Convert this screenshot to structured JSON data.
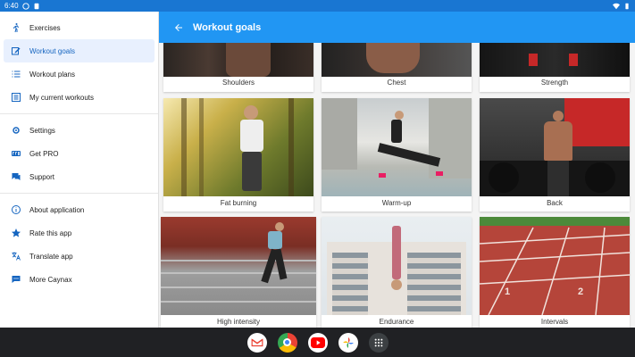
{
  "status_bar": {
    "time": "6:40"
  },
  "sidebar": {
    "items": [
      {
        "label": "Exercises",
        "icon": "walking-person-icon"
      },
      {
        "label": "Workout goals",
        "icon": "edit-icon",
        "active": true
      },
      {
        "label": "Workout plans",
        "icon": "list-icon"
      },
      {
        "label": "My current workouts",
        "icon": "checklist-icon"
      },
      {
        "label": "Settings",
        "icon": "settings-icon"
      },
      {
        "label": "Get PRO",
        "icon": "pro-badge-icon"
      },
      {
        "label": "Support",
        "icon": "chat-icon"
      },
      {
        "label": "About application",
        "icon": "info-icon"
      },
      {
        "label": "Rate this app",
        "icon": "star-icon"
      },
      {
        "label": "Translate app",
        "icon": "translate-icon"
      },
      {
        "label": "More Caynax",
        "icon": "more-apps-icon"
      }
    ]
  },
  "appbar": {
    "title": "Workout goals"
  },
  "goals": [
    {
      "label": "Shoulders"
    },
    {
      "label": "Chest"
    },
    {
      "label": "Strength"
    },
    {
      "label": "Fat burning"
    },
    {
      "label": "Warm-up"
    },
    {
      "label": "Back"
    },
    {
      "label": "High intensity"
    },
    {
      "label": "Endurance"
    },
    {
      "label": "Intervals"
    }
  ],
  "taskbar": {
    "apps": [
      "gmail-icon",
      "chrome-icon",
      "youtube-icon",
      "photos-icon",
      "app-launcher-icon"
    ]
  },
  "colors": {
    "status_bar": "#1976d2",
    "app_bar": "#2196f3",
    "active_item_bg": "#e8f0fe",
    "active_item_text": "#1565c0",
    "taskbar": "#202124"
  }
}
